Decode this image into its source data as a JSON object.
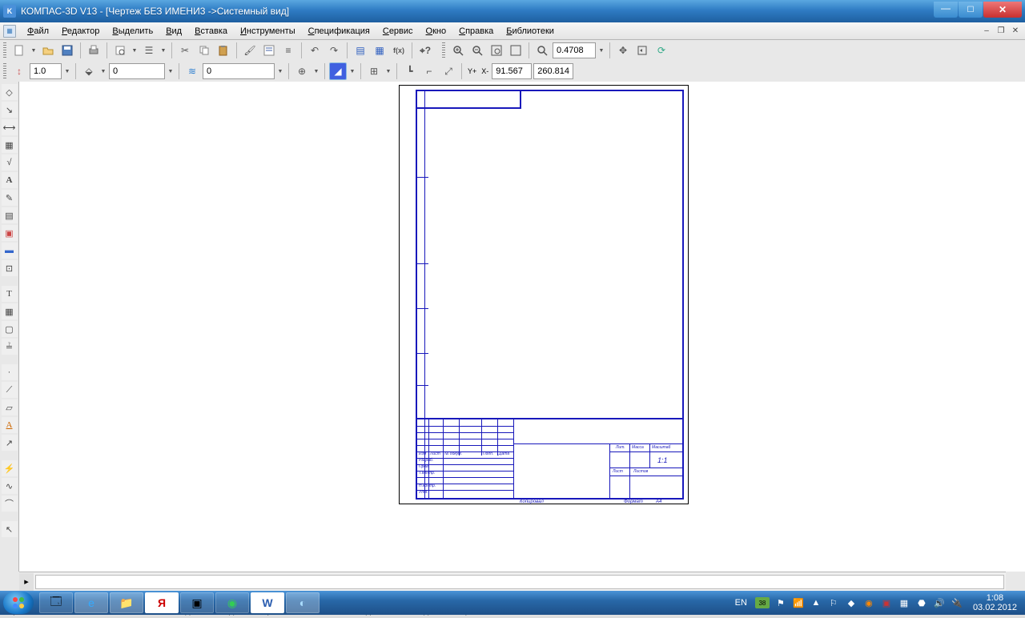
{
  "title": "КОМПАС-3D V13 - [Чертеж БЕЗ ИМЕНИ3 ->Системный вид]",
  "menu": [
    "Файл",
    "Редактор",
    "Выделить",
    "Вид",
    "Вставка",
    "Инструменты",
    "Спецификация",
    "Сервис",
    "Окно",
    "Справка",
    "Библиотеки"
  ],
  "tb1": {
    "zoom_value": "0.4708"
  },
  "tb2": {
    "scale": "1.0",
    "layer": "0",
    "style_num": "0",
    "coord_label_y": "Y+",
    "coord_label_x": "X-",
    "x": "91.567",
    "y": "260.814"
  },
  "sheet": {
    "scale_text": "1:1",
    "copied": "Копировал",
    "format": "Формат",
    "format_size": "А4",
    "tb_labels": {
      "izm": "Изм",
      "list": "Лист",
      "ndok": "№ докум.",
      "podp": "Подп.",
      "data": "Дата",
      "razrab": "Разраб.",
      "prov": "Пров.",
      "tkontr": "Т.контр.",
      "nkontr": "Н.контр.",
      "utv": "Утв.",
      "lit": "Лит.",
      "massa": "Масса",
      "masshtab": "Масштаб",
      "list2": "Лист",
      "listov": "Листов"
    }
  },
  "status": "Щелкните левой кнопкой мыши на объекте для его выделения (вместе с Ctrl или Shift - добавить к выделенным)",
  "taskbar": {
    "lang": "EN",
    "kb": "38",
    "time": "1:08",
    "date": "03.02.2012"
  }
}
